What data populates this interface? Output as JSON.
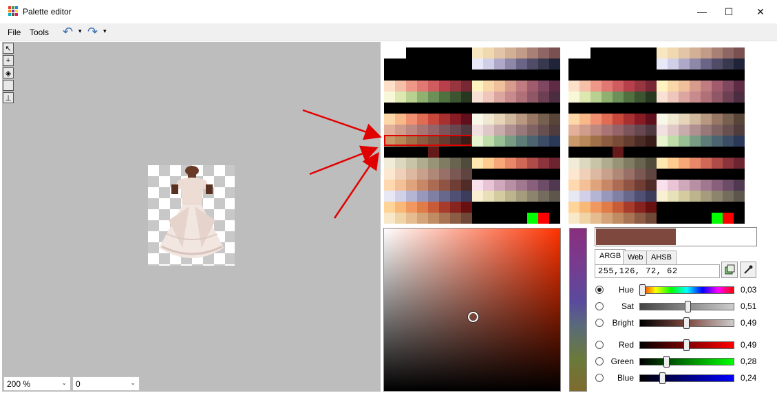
{
  "window": {
    "title": "Palette editor",
    "minimize": "—",
    "maximize": "☐",
    "close": "✕"
  },
  "menu": {
    "file": "File",
    "tools": "Tools",
    "undo_icon": "↶",
    "redo_icon": "↷",
    "dropdown": "▾"
  },
  "tools": [
    "pointer-icon",
    "add-icon",
    "fill-icon",
    "rect-icon",
    "stamp-icon"
  ],
  "zoom": {
    "value": "200 %",
    "arrow": "⌄"
  },
  "index": {
    "value": "0",
    "arrow": "⌄"
  },
  "colors": {
    "selected": "#7e483e",
    "arrow": "#e00000"
  },
  "palette_left": [
    [
      "#ffffff",
      "#ffffff",
      "#000000",
      "#000000",
      "#000000",
      "#000000",
      "#000000",
      "#000000",
      "#f8e6c0",
      "#f0d8b0",
      "#e2c4a6",
      "#d2b096",
      "#c29c88",
      "#a88076",
      "#8e6664",
      "#7a5050"
    ],
    [
      "#000000",
      "#000000",
      "#000000",
      "#000000",
      "#000000",
      "#000000",
      "#000000",
      "#000000",
      "#e8e8f8",
      "#cfcfe8",
      "#b0a8c8",
      "#8e88a8",
      "#6a6486",
      "#504c68",
      "#38384e",
      "#202438"
    ],
    [
      "#000000",
      "#000000",
      "#000000",
      "#000000",
      "#000000",
      "#000000",
      "#000000",
      "#000000",
      "#000000",
      "#000000",
      "#000000",
      "#000000",
      "#000000",
      "#000000",
      "#000000",
      "#000000"
    ],
    [
      "#fce0c8",
      "#f6c0a8",
      "#ee9888",
      "#e27874",
      "#d05c60",
      "#b8404c",
      "#983640",
      "#782834",
      "#fff4c0",
      "#f8d8a8",
      "#f0c09c",
      "#d89c8c",
      "#c07c80",
      "#a05c6c",
      "#804860",
      "#5e2c44"
    ],
    [
      "#f8f8d8",
      "#dce8b0",
      "#b8d090",
      "#90b070",
      "#6c9058",
      "#507040",
      "#3c5430",
      "#283820",
      "#f8e0d4",
      "#eec6bc",
      "#dca6a0",
      "#c88a8c",
      "#b07078",
      "#905866",
      "#6c4052",
      "#4c2c40"
    ],
    [
      "#000000",
      "#000000",
      "#000000",
      "#000000",
      "#000000",
      "#000000",
      "#000000",
      "#000000",
      "#000000",
      "#000000",
      "#000000",
      "#000000",
      "#000000",
      "#000000",
      "#000000",
      "#000000"
    ],
    [
      "#fcd8a8",
      "#f8b888",
      "#f09070",
      "#e06c54",
      "#c8483c",
      "#a83030",
      "#881c24",
      "#60101c",
      "#f8f8e8",
      "#f0e8d0",
      "#e6d4b8",
      "#d0b89c",
      "#b89880",
      "#987864",
      "#786050",
      "#584438"
    ],
    [
      "#e4b09c",
      "#d09c8c",
      "#bc8880",
      "#a87474",
      "#946468",
      "#7c545c",
      "#684850",
      "#503840",
      "#f0e0e0",
      "#e0c8c8",
      "#c8acac",
      "#b09090",
      "#987878",
      "#806464",
      "#685050",
      "#503c3c"
    ],
    [
      "#c89a6a",
      "#b88858",
      "#a07048",
      "#8c5c40",
      "#784c38",
      "#643c30",
      "#4c2c24",
      "#381c18",
      "#e8f4d0",
      "#c0dca8",
      "#98c094",
      "#789c84",
      "#5e7c78",
      "#4c6470",
      "#3c4c64",
      "#2c3858"
    ],
    [
      "#000000",
      "#000000",
      "#000000",
      "#000000",
      "#641a1a",
      "#000000",
      "#000000",
      "#000000",
      "#000000",
      "#000000",
      "#000000",
      "#000000",
      "#000000",
      "#000000",
      "#000000",
      "#000000"
    ],
    [
      "#f0ecd8",
      "#dcd8c0",
      "#c8c4a8",
      "#b0ac90",
      "#989478",
      "#807c64",
      "#686450",
      "#504c3c",
      "#ffe8b0",
      "#ffcc90",
      "#f8a878",
      "#e88868",
      "#d06858",
      "#b04c48",
      "#8c343c",
      "#6c2430"
    ],
    [
      "#fce8d0",
      "#f0d0b8",
      "#dcb8a0",
      "#c8a08c",
      "#b08878",
      "#987068",
      "#7c5854",
      "#604440",
      "#000000",
      "#000000",
      "#000000",
      "#000000",
      "#000000",
      "#000000",
      "#000000",
      "#000000"
    ],
    [
      "#ffd8b0",
      "#f4c098",
      "#e0a47c",
      "#c88868",
      "#ac6c54",
      "#905444",
      "#703e34",
      "#502c28",
      "#f8e0ec",
      "#e8c4d4",
      "#d0a8bc",
      "#b890a4",
      "#a07890",
      "#88607c",
      "#6c4c66",
      "#503850"
    ],
    [
      "#e8e8f4",
      "#d0d0e8",
      "#b4b4d4",
      "#9898bc",
      "#8080a4",
      "#68688c",
      "#505074",
      "#3c3c5c",
      "#f8f0d0",
      "#e8e0b8",
      "#d4cca0",
      "#bcb48c",
      "#a49c7c",
      "#8c846c",
      "#746c5c",
      "#5c564c"
    ],
    [
      "#ffd498",
      "#f8b878",
      "#f09860",
      "#e07c48",
      "#c85c38",
      "#a83c2c",
      "#882420",
      "#681010",
      "#000000",
      "#000000",
      "#000000",
      "#000000",
      "#000000",
      "#000000",
      "#000000",
      "#000000"
    ],
    [
      "#f8e8c8",
      "#f0d4a8",
      "#e4bc90",
      "#d4a478",
      "#c08c64",
      "#a87454",
      "#8c5c44",
      "#704838",
      "#000000",
      "#000000",
      "#000000",
      "#000000",
      "#000000",
      "#000000",
      "#000000",
      "#000000"
    ]
  ],
  "picker_swatches": {
    "green": "#00ff00",
    "red": "#ff0000"
  },
  "tabs": [
    "ARGB",
    "Web",
    "AHSB"
  ],
  "argb_value": "255,126, 72, 62",
  "sliders": [
    {
      "label": "Hue",
      "value": "0,03",
      "level": 0.03,
      "checked": true
    },
    {
      "label": "Sat",
      "value": "0,51",
      "level": 0.51,
      "checked": false
    },
    {
      "label": "Bright",
      "value": "0,49",
      "level": 0.49,
      "checked": false
    },
    {
      "label": "Red",
      "value": "0,49",
      "level": 0.49,
      "checked": false
    },
    {
      "label": "Green",
      "value": "0,28",
      "level": 0.28,
      "checked": false
    },
    {
      "label": "Blue",
      "value": "0,24",
      "level": 0.24,
      "checked": false
    }
  ],
  "icons": {
    "add_swatch": "add-swatch-icon",
    "eyedropper": "eyedropper-icon"
  }
}
